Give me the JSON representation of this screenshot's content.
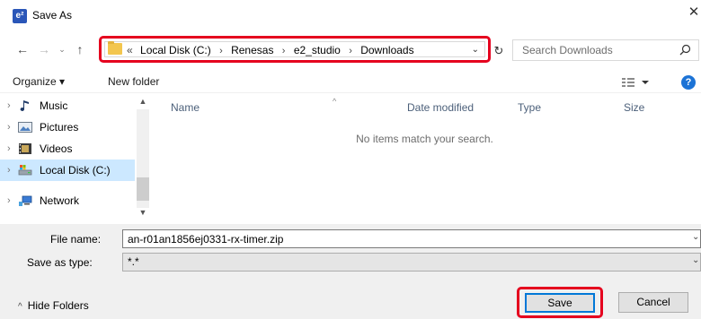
{
  "window": {
    "title": "Save As",
    "app_icon_text": "e²",
    "close_glyph": "✕"
  },
  "nav": {
    "back_glyph": "←",
    "forward_glyph": "→",
    "recent_glyph": "⌄",
    "up_glyph": "↑",
    "address_lead": "«",
    "breadcrumbs": [
      "Local Disk (C:)",
      "Renesas",
      "e2_studio",
      "Downloads"
    ],
    "crumb_separator": "›",
    "address_dropdown_glyph": "⌄",
    "refresh_glyph": "↻",
    "search_placeholder": "Search Downloads"
  },
  "toolbar": {
    "organize_label": "Organize ▾",
    "new_folder_label": "New folder",
    "help_glyph": "?"
  },
  "tree": {
    "items": [
      {
        "label": "Music",
        "icon": "music-icon",
        "arrow": "›"
      },
      {
        "label": "Pictures",
        "icon": "pictures-icon",
        "arrow": "›"
      },
      {
        "label": "Videos",
        "icon": "videos-icon",
        "arrow": "›"
      },
      {
        "label": "Local Disk (C:)",
        "icon": "drive-icon",
        "arrow": "›",
        "selected": true
      },
      {
        "label": "Network",
        "icon": "network-icon",
        "arrow": "›"
      }
    ]
  },
  "file_list": {
    "columns": [
      "Name",
      "Date modified",
      "Type",
      "Size"
    ],
    "sort_glyph": "^",
    "empty_message": "No items match your search."
  },
  "form": {
    "file_name_label": "File name:",
    "file_name_value": "an-r01an1856ej0331-rx-timer.zip",
    "save_type_label": "Save as type:",
    "save_type_value": "*.*",
    "dropdown_glyph": "⌄"
  },
  "footer": {
    "hide_folders_glyph": "^",
    "hide_folders_label": "Hide Folders",
    "save_label": "Save",
    "cancel_label": "Cancel"
  },
  "colors": {
    "highlight_border": "#e5001e",
    "selection": "#cce8ff",
    "accent": "#0078d7",
    "folder": "#f3c64e"
  }
}
